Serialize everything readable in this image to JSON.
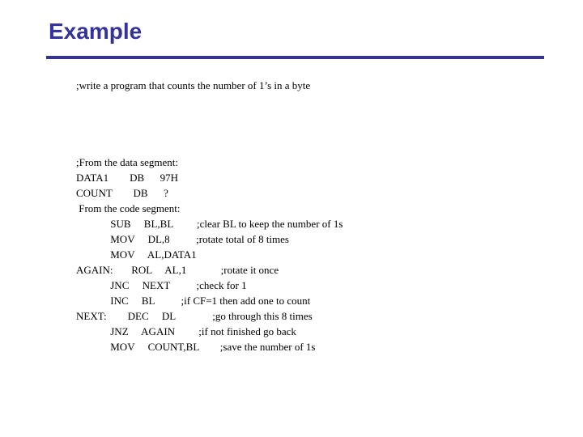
{
  "slide": {
    "title": "Example",
    "accent_color": "#333399",
    "background_color": "#ffffff",
    "text_color": "#000000"
  },
  "content": {
    "intro_comment": ";write a program that counts the number of 1’s in a byte",
    "data_segment_header": ";From the data segment:",
    "code_segment_header": " From the code segment:",
    "data_lines": [
      "DATA1        DB      97H",
      "COUNT        DB      ?"
    ],
    "code_block": "             SUB     BL,BL         ;clear BL to keep the number of 1s\n             MOV     DL,8          ;rotate total of 8 times\n             MOV     AL,DATA1\nAGAIN:       ROL     AL,1             ;rotate it once\n             JNC     NEXT          ;check for 1\n             INC     BL          ;if CF=1 then add one to count\nNEXT:        DEC     DL              ;go through this 8 times\n             JNZ     AGAIN         ;if not finished go back\n             MOV     COUNT,BL        ;save the number of 1s",
    "instructions": [
      {
        "label": "",
        "mnemonic": "SUB",
        "operands": "BL,BL",
        "comment": ";clear BL to keep the number of 1s"
      },
      {
        "label": "",
        "mnemonic": "MOV",
        "operands": "DL,8",
        "comment": ";rotate total of 8 times"
      },
      {
        "label": "",
        "mnemonic": "MOV",
        "operands": "AL,DATA1",
        "comment": ""
      },
      {
        "label": "AGAIN:",
        "mnemonic": "ROL",
        "operands": "AL,1",
        "comment": ";rotate it once"
      },
      {
        "label": "",
        "mnemonic": "JNC",
        "operands": "NEXT",
        "comment": ";check for 1"
      },
      {
        "label": "",
        "mnemonic": "INC",
        "operands": "BL",
        "comment": ";if CF=1 then add one to count"
      },
      {
        "label": "NEXT:",
        "mnemonic": "DEC",
        "operands": "DL",
        "comment": ";go through this 8 times"
      },
      {
        "label": "",
        "mnemonic": "JNZ",
        "operands": "AGAIN",
        "comment": ";if not finished go back"
      },
      {
        "label": "",
        "mnemonic": "MOV",
        "operands": "COUNT,BL",
        "comment": ";save the number of 1s"
      }
    ]
  }
}
